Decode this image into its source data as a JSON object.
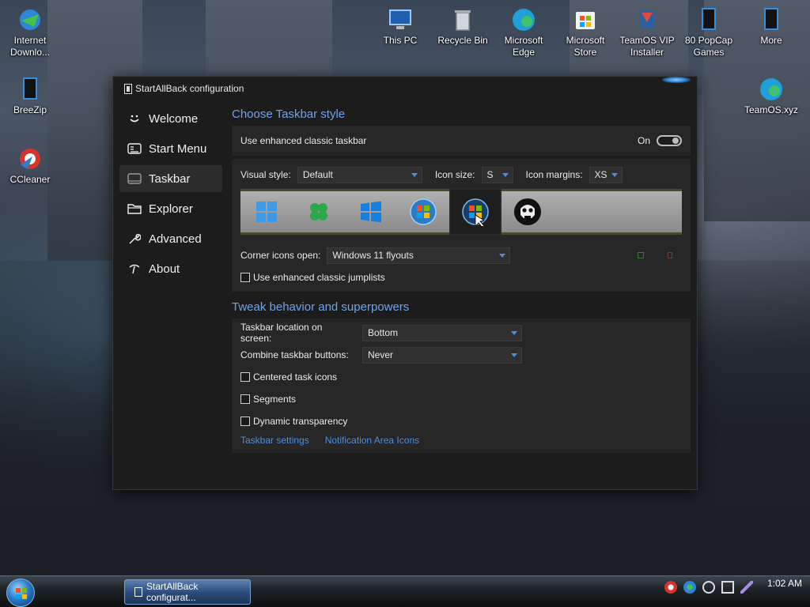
{
  "desktop": {
    "icons": [
      {
        "label": "Internet Downlo..."
      },
      {
        "label": "BreeZip"
      },
      {
        "label": "CCleaner"
      },
      {
        "label": "This PC"
      },
      {
        "label": "Recycle Bin"
      },
      {
        "label": "Microsoft Edge"
      },
      {
        "label": "Microsoft Store"
      },
      {
        "label": "TeamOS VIP Installer"
      },
      {
        "label": "80 PopCap Games"
      },
      {
        "label": "More"
      },
      {
        "label": "TeamOS.xyz"
      }
    ]
  },
  "window": {
    "title": "StartAllBack configuration",
    "sidebar": {
      "items": [
        {
          "label": "Welcome",
          "icon": "smile-icon"
        },
        {
          "label": "Start Menu",
          "icon": "start-menu-icon"
        },
        {
          "label": "Taskbar",
          "icon": "taskbar-icon"
        },
        {
          "label": "Explorer",
          "icon": "folder-icon"
        },
        {
          "label": "Advanced",
          "icon": "wrench-icon"
        },
        {
          "label": "About",
          "icon": "info-icon"
        }
      ],
      "active": "Taskbar"
    },
    "section1": {
      "title": "Choose Taskbar style",
      "enhanced_label": "Use enhanced classic taskbar",
      "toggle_state": "On",
      "visual_style_label": "Visual style:",
      "visual_style_value": "Default",
      "icon_size_label": "Icon size:",
      "icon_size_value": "S",
      "icon_margins_label": "Icon margins:",
      "icon_margins_value": "XS",
      "corner_icons_label": "Corner icons open:",
      "corner_icons_value": "Windows 11 flyouts",
      "jumplists_label": "Use enhanced classic jumplists"
    },
    "section2": {
      "title": "Tweak behavior and superpowers",
      "location_label": "Taskbar location on screen:",
      "location_value": "Bottom",
      "combine_label": "Combine taskbar buttons:",
      "combine_value": "Never",
      "centered_label": "Centered task icons",
      "segments_label": "Segments",
      "dynamic_label": "Dynamic transparency",
      "link1": "Taskbar settings",
      "link2": "Notification Area Icons"
    }
  },
  "taskbar": {
    "button_label": "StartAllBack configurat...",
    "clock": "1:02 AM"
  },
  "colors": {
    "accent": "#6ea4e8",
    "link": "#4b8fe0",
    "window_bg": "#1c1c1c",
    "card_bg": "#262626"
  }
}
